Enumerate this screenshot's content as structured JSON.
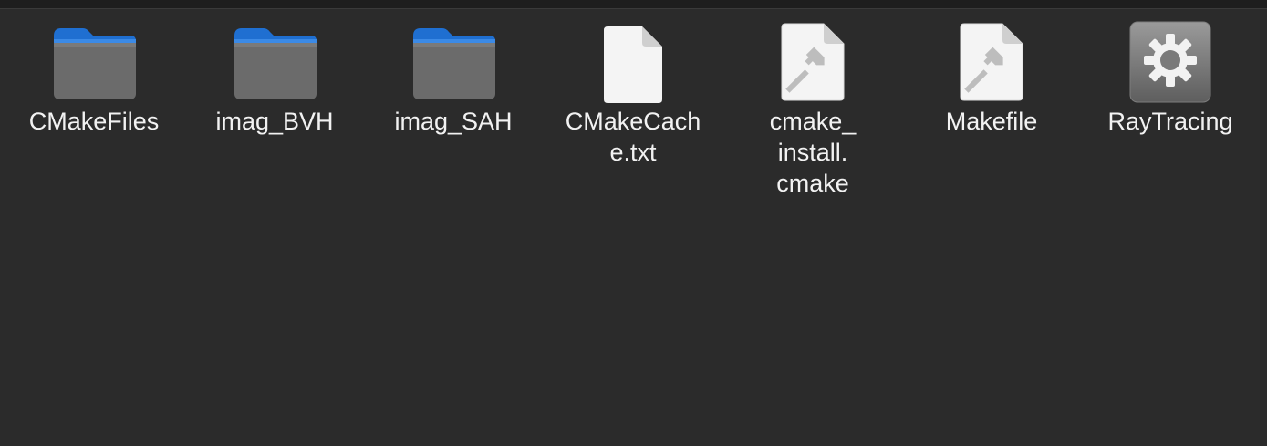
{
  "window": {
    "area": "file-manager-icon-view"
  },
  "files": [
    {
      "name": "CMakeFiles",
      "kind": "folder",
      "icon": "folder-icon"
    },
    {
      "name": "imag_BVH",
      "kind": "folder",
      "icon": "folder-icon"
    },
    {
      "name": "imag_SAH",
      "kind": "folder",
      "icon": "folder-icon"
    },
    {
      "name_lines": [
        "CMakeCach",
        "e.txt"
      ],
      "name": "CMakeCache.txt",
      "kind": "text",
      "icon": "text-file-icon"
    },
    {
      "name_lines": [
        "cmake_",
        "install.",
        "cmake"
      ],
      "name": "cmake_install.cmake",
      "kind": "makefile",
      "icon": "build-script-icon"
    },
    {
      "name": "Makefile",
      "kind": "makefile",
      "icon": "build-script-icon"
    },
    {
      "name": "RayTracing",
      "kind": "executable",
      "icon": "executable-gear-icon"
    }
  ],
  "colors": {
    "background": "#2b2b2b",
    "folder_tab": "#1f6fd1",
    "folder_body": "#6b6b6b",
    "file_paper": "#f4f4f4",
    "label_text": "#f2f2f2"
  }
}
